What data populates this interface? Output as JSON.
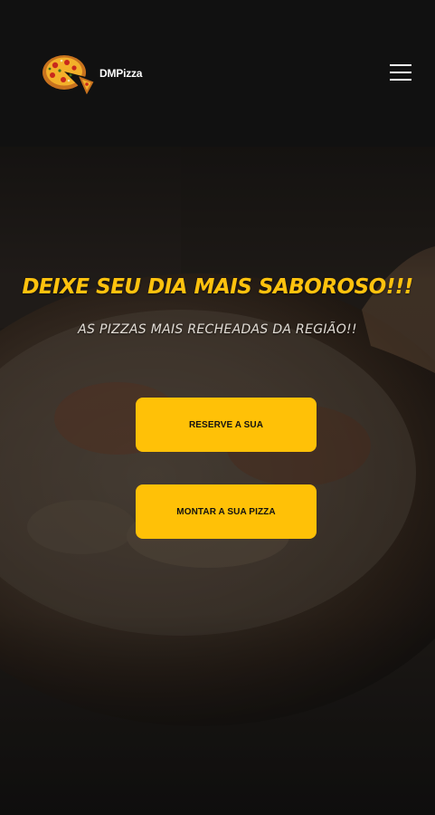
{
  "header": {
    "brand_name": "DMPizza",
    "logo_icon": "pizza-logo-icon",
    "menu_icon": "hamburger-menu-icon"
  },
  "hero": {
    "title": "DEIXE SEU DIA MAIS SABOROSO!!!",
    "subtitle": "AS PIZZAS MAIS RECHEADAS DA REGIÃO!!",
    "background_icon": "pizza-photo-background"
  },
  "buttons": {
    "reserve_label": "RESERVE A SUA",
    "build_label": "MONTAR A SUA PIZZA"
  },
  "colors": {
    "accent": "#ffc107",
    "title": "#ffc20e",
    "header_bg": "#111111"
  }
}
